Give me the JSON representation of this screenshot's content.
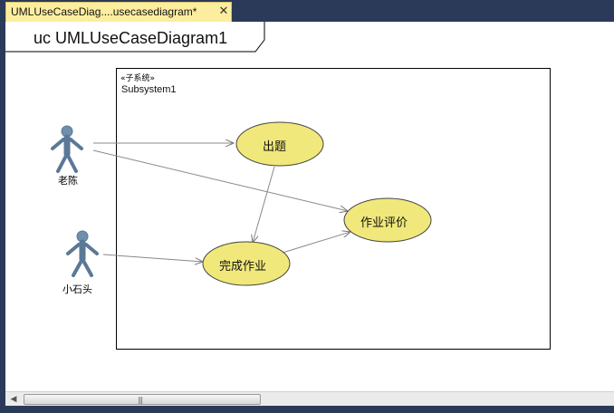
{
  "document_tab": {
    "title": "UMLUseCaseDiag....usecasediagram*",
    "close_glyph": "✕"
  },
  "frame": {
    "title": "uc UMLUseCaseDiagram1"
  },
  "subsystem": {
    "stereotype": "«子系统»",
    "name": "Subsystem1"
  },
  "actors": [
    {
      "label": "老陈"
    },
    {
      "label": "小石头"
    }
  ],
  "use_cases": [
    {
      "label": "出题"
    },
    {
      "label": "作业评价"
    },
    {
      "label": "完成作业"
    }
  ],
  "colors": {
    "use_case_fill": "#f0e87a",
    "actor_fill": "#6f8fae",
    "tab_active": "#fcee9e",
    "chrome": "#2b3a58"
  },
  "scrollbar": {
    "left_arrow_icon": "triangle-left-icon",
    "grip": "|||"
  }
}
